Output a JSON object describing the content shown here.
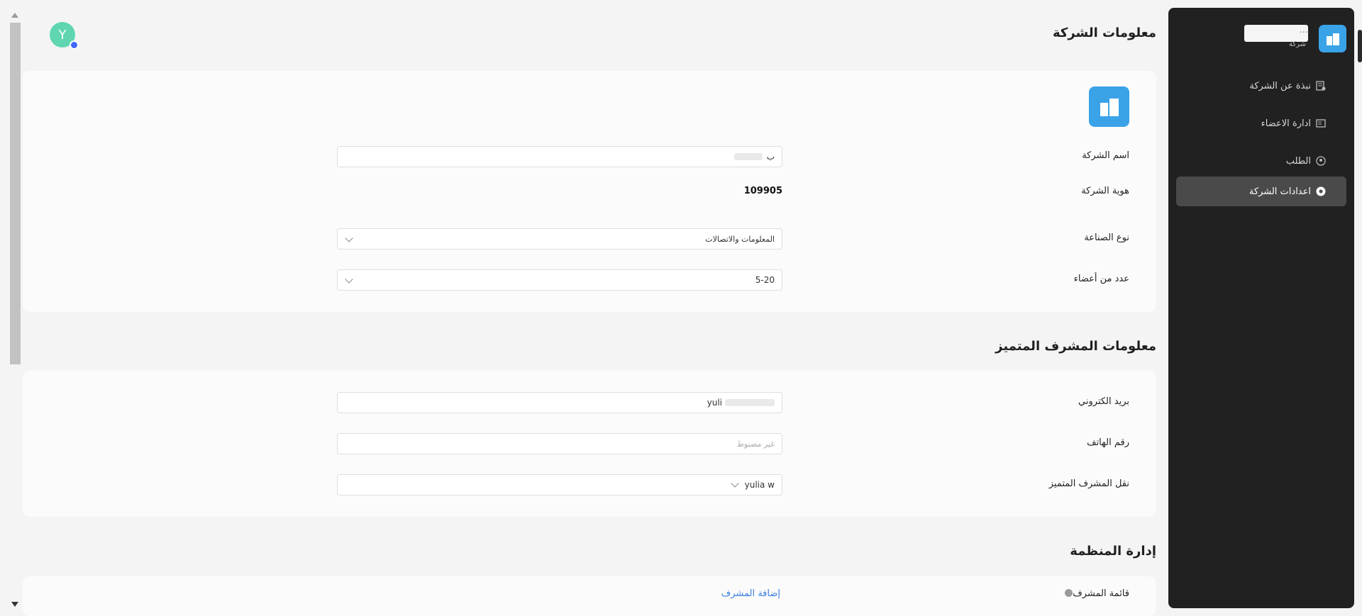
{
  "avatar": {
    "initial": "Y"
  },
  "company_info": {
    "title": "معلومات الشركة",
    "name_label": "اسم الشركة",
    "name_value": "ب",
    "id_label": "هوية الشركة",
    "id_value": "109905",
    "industry_label": "نوع الصناعة",
    "industry_value": "المعلومات والاتصالات",
    "members_label": "عدد من أعضاء",
    "members_value": "5-20"
  },
  "admin_info": {
    "title": "معلومات المشرف المتميز",
    "email_label": "بريد الكتروني",
    "email_value": "yuli",
    "phone_label": "رقم الهاتف",
    "phone_placeholder": "غير مضبوط",
    "transfer_label": "نقل المشرف المتميز",
    "transfer_value": "yulia w"
  },
  "org_mgmt": {
    "title": "إدارة المنظمة",
    "admin_list_label": "قائمة المشرف",
    "add_admin_link": "إضافة المشرف"
  },
  "sidebar": {
    "company_name": "...",
    "company_subtitle": "شركة",
    "items": [
      {
        "label": "نبذة عن الشركة",
        "icon": "company-info-icon"
      },
      {
        "label": "ادارة الاعضاء",
        "icon": "members-icon"
      },
      {
        "label": "الطلب",
        "icon": "request-icon"
      },
      {
        "label": "اعدادات الشركة",
        "icon": "gear-icon",
        "active": true
      }
    ]
  },
  "colors": {
    "accent": "#3aa3e8",
    "sidebar_bg": "#212121",
    "link": "#3a7ee0"
  }
}
